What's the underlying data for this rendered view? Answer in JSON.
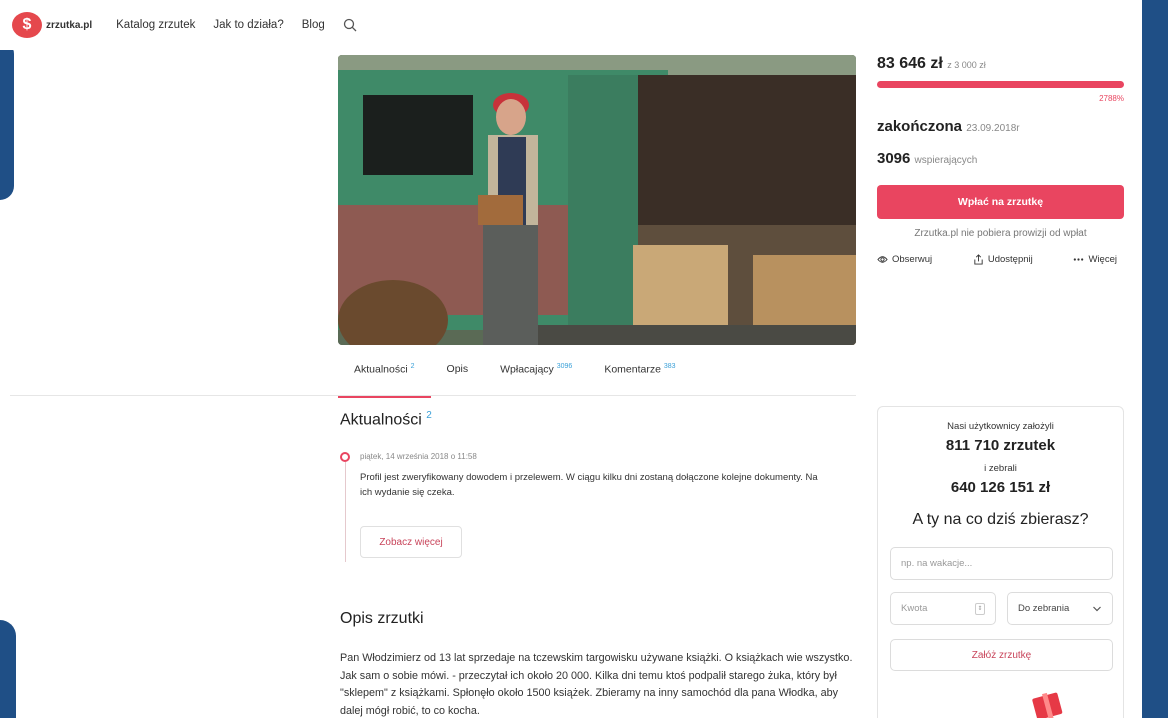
{
  "header": {
    "logo_text": "zrzutka.pl",
    "nav": [
      "Katalog zrzutek",
      "Jak to działa?",
      "Blog"
    ]
  },
  "campaign": {
    "amount": "83 646 zł",
    "goal": "z 3 000 zł",
    "progress_fraction": 1.0,
    "percent": "2788%",
    "status": "zakończona",
    "end_date": "23.09.2018r",
    "supporters_count": "3096",
    "supporters_label": "wspierających",
    "pay_button": "Wpłać na zrzutkę",
    "no_fee_text": "Zrzutka.pl nie pobiera prowizji od wpłat",
    "actions": {
      "follow": "Obserwuj",
      "share": "Udostępnij",
      "more": "Więcej"
    }
  },
  "tabs": [
    {
      "label": "Aktualności",
      "count": "2"
    },
    {
      "label": "Opis",
      "count": ""
    },
    {
      "label": "Wpłacający",
      "count": "3096"
    },
    {
      "label": "Komentarze",
      "count": "383"
    }
  ],
  "updates": {
    "title": "Aktualności",
    "count": "2",
    "date": "piątek, 14 września 2018 o 11:58",
    "text": "Profil jest zweryfikowany dowodem i przelewem. W ciągu kilku dni zostaną dołączone kolejne dokumenty. Na ich wydanie się czeka.",
    "more_button": "Zobacz więcej"
  },
  "description": {
    "title": "Opis zrzutki",
    "text": "Pan Włodzimierz od 13 lat sprzedaje na tczewskim targowisku używane książki. O książkach wie wszystko. Jak sam o sobie mówi. - przeczytał ich około 20 000. Kilka dni temu ktoś podpalił starego żuka, który był \"sklepem\" z książkami. Spłonęło około 1500 książek. Zbieramy na inny samochód dla pana Włodka, aby dalej mógł robić, to co kocha."
  },
  "stats_card": {
    "line1": "Nasi użytkownicy założyli",
    "count1": "811 710 zrzutek",
    "line2": "i zebrali",
    "count2": "640 126 151 zł",
    "question": "A ty na co dziś zbierasz?",
    "input_placeholder": "np. na wakacje...",
    "amount_placeholder": "Kwota",
    "select_value": "Do zebrania",
    "create_button": "Załóż zrzutkę"
  }
}
